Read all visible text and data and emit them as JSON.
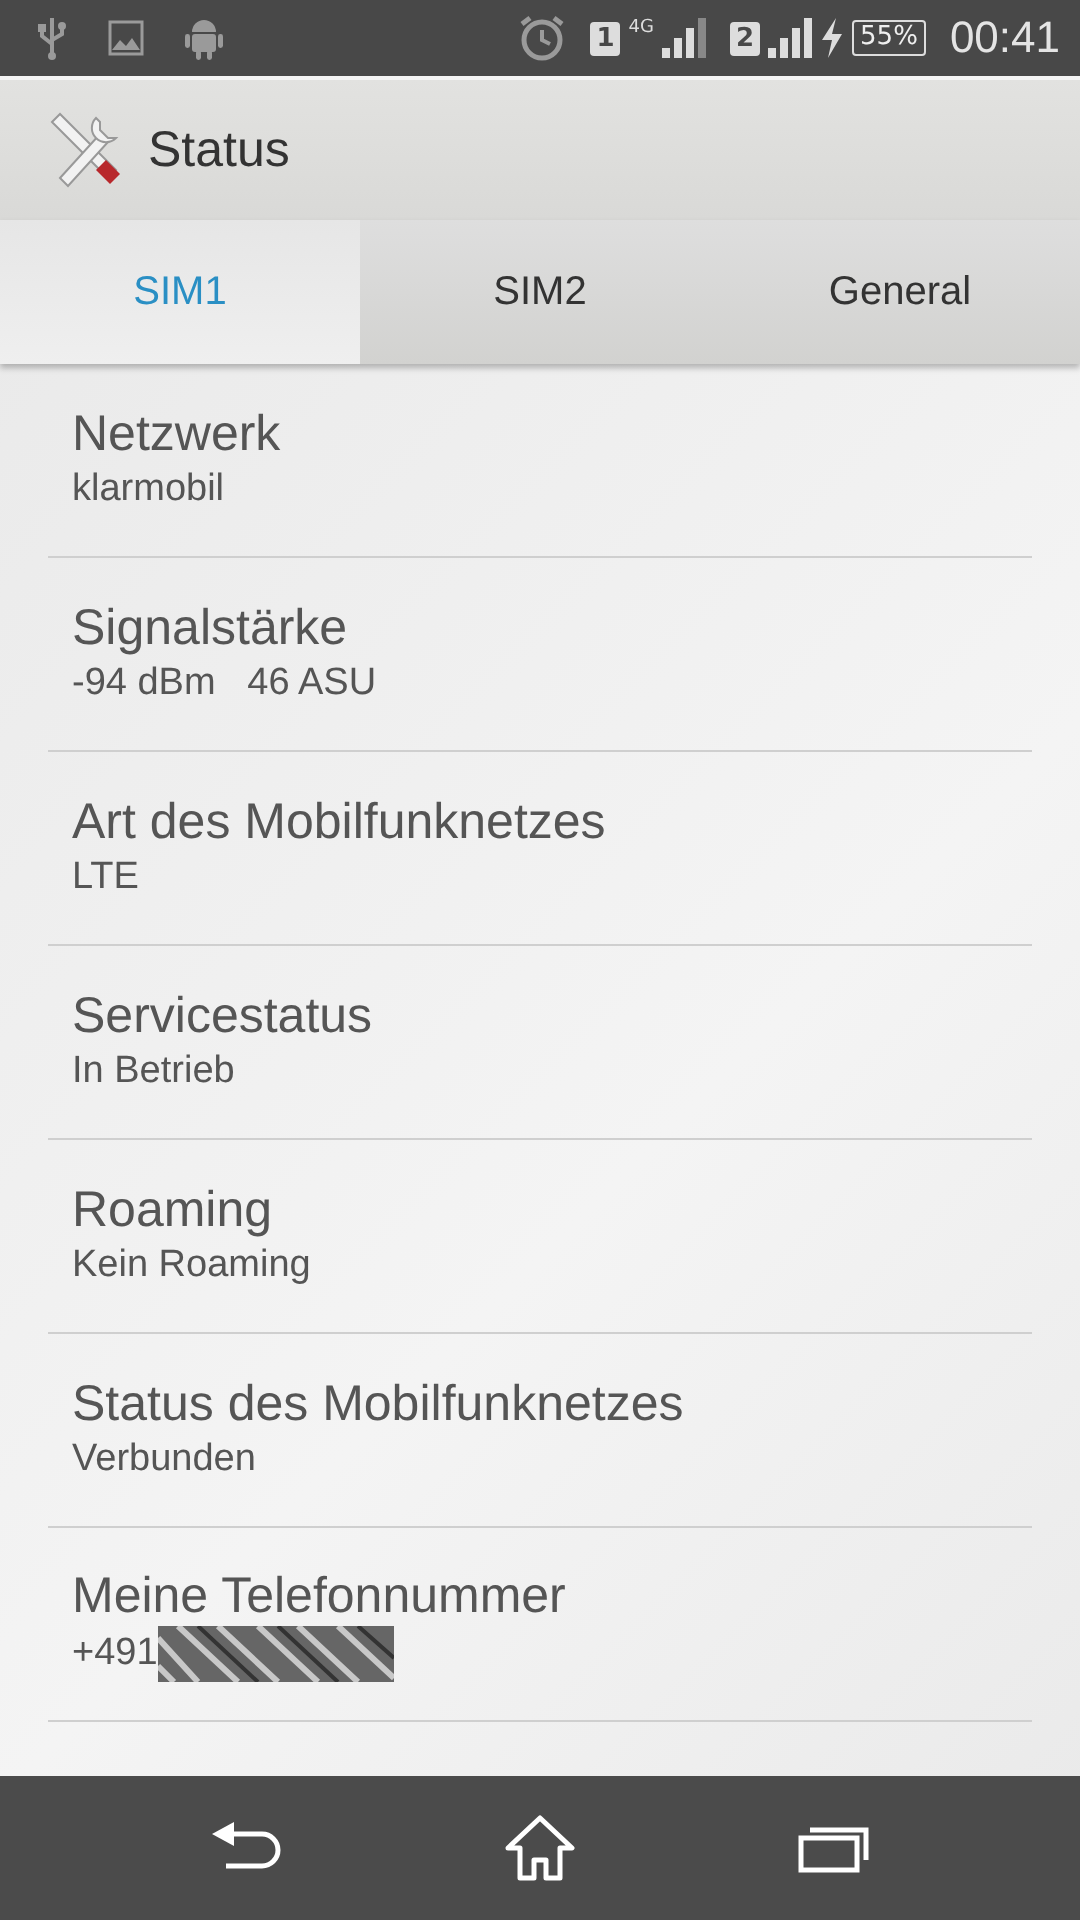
{
  "status_bar": {
    "sim1_badge": "1",
    "sim1_network": "4G",
    "sim2_badge": "2",
    "battery": "55%",
    "time": "00:41"
  },
  "action_bar": {
    "title": "Status"
  },
  "tabs": [
    {
      "label": "SIM1",
      "selected": true
    },
    {
      "label": "SIM2",
      "selected": false
    },
    {
      "label": "General",
      "selected": false
    }
  ],
  "items": [
    {
      "title": "Netzwerk",
      "value": "klarmobil"
    },
    {
      "title": "Signalstärke",
      "value": "-94 dBm   46 ASU"
    },
    {
      "title": "Art des Mobilfunknetzes",
      "value": "LTE"
    },
    {
      "title": "Servicestatus",
      "value": "In Betrieb"
    },
    {
      "title": "Roaming",
      "value": "Kein Roaming"
    },
    {
      "title": "Status des Mobilfunknetzes",
      "value": "Verbunden"
    },
    {
      "title": "Meine Telefonnummer",
      "value": "+491",
      "redacted": true
    }
  ]
}
